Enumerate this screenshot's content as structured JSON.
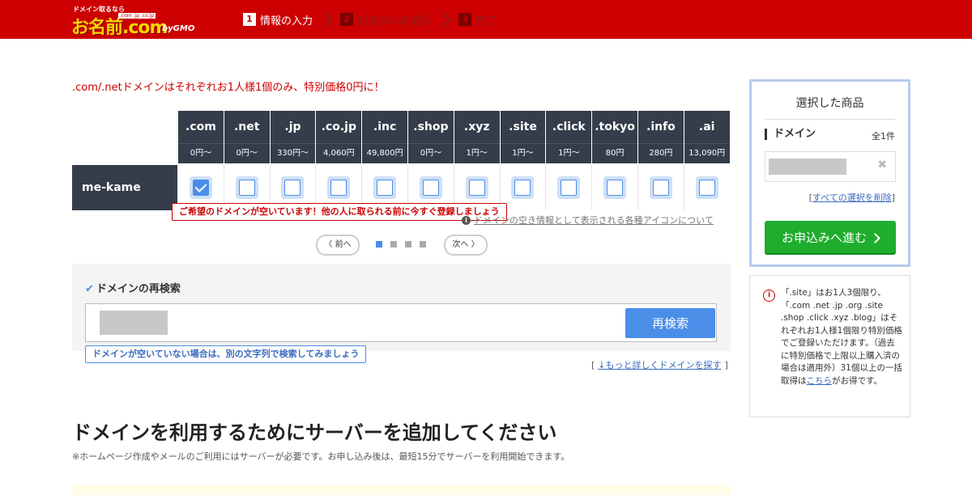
{
  "header": {
    "logo_tagline": "ドメイン取るなら",
    "logo_name": "お名前.com",
    "logo_tlds": ".com .jp .co.jp",
    "logo_gmo": "byGMO",
    "steps": [
      {
        "num": "1",
        "label": "情報の入力",
        "active": true
      },
      {
        "num": "2",
        "label": "お支払いの選択",
        "active": false
      },
      {
        "num": "3",
        "label": "完了",
        "active": false
      }
    ]
  },
  "promo_text": ".com/.netドメインはそれぞれお1人様1個のみ、特別価格0円に！",
  "domain_grid": {
    "domain_name": "me-kame",
    "tlds": [
      {
        "name": ".com",
        "price": "0円〜",
        "checked": true
      },
      {
        "name": ".net",
        "price": "0円〜",
        "checked": false
      },
      {
        "name": ".jp",
        "price": "330円〜",
        "checked": false
      },
      {
        "name": ".co.jp",
        "price": "4,060円",
        "checked": false
      },
      {
        "name": ".inc",
        "price": "49,800円",
        "checked": false
      },
      {
        "name": ".shop",
        "price": "0円〜",
        "checked": false
      },
      {
        "name": ".xyz",
        "price": "1円〜",
        "checked": false
      },
      {
        "name": ".site",
        "price": "1円〜",
        "checked": false
      },
      {
        "name": ".click",
        "price": "1円〜",
        "checked": false
      },
      {
        "name": ".tokyo",
        "price": "80円",
        "checked": false
      },
      {
        "name": ".info",
        "price": "280円",
        "checked": false
      },
      {
        "name": ".ai",
        "price": "13,090円",
        "checked": false
      }
    ],
    "available_tooltip": "ご希望のドメインが空いています！他の人に取られる前に今すぐ登録しましょう",
    "icon_info_link": "ドメインの空き情報として表示される各種アイコンについて"
  },
  "pager": {
    "prev_label": "〈 前へ",
    "next_label": "次へ 〉",
    "pages": 4,
    "current_page": 1
  },
  "research": {
    "title": "ドメインの再検索",
    "search_value": "",
    "search_button": "再検索",
    "hint_tooltip": "ドメインが空いていない場合は、別の文字列で検索してみましょう",
    "more_link": "↓もっと詳しくドメインを探す"
  },
  "server": {
    "title": "ドメインを利用するためにサーバーを追加してください",
    "note": "※ホームページ作成やメールのご利用にはサーバーが必要です。お申し込み後は、最短15分でサーバーを利用開始できます。"
  },
  "cart": {
    "title": "選択した商品",
    "domain_label": "ドメイン",
    "count": "全1件",
    "clear_link": "すべての選択を削除",
    "cta_label": "お申込みへ進む"
  },
  "notice": {
    "text": "「.site」はお1人3個限り、「.com .net .jp .org .site .shop .click .xyz .blog」はそれぞれお1人様1個限り特別価格でご登録いただけます。（過去に特別価格で上限以上購入済の場合は適用外）31個以上の一括取得は",
    "link": "こちら",
    "suffix": "がお得です。"
  },
  "colors": {
    "brand_red": "#cc0000",
    "header_dark": "#353d4a",
    "accent_blue": "#4a8ee8",
    "cta_green": "#1fad2e"
  }
}
